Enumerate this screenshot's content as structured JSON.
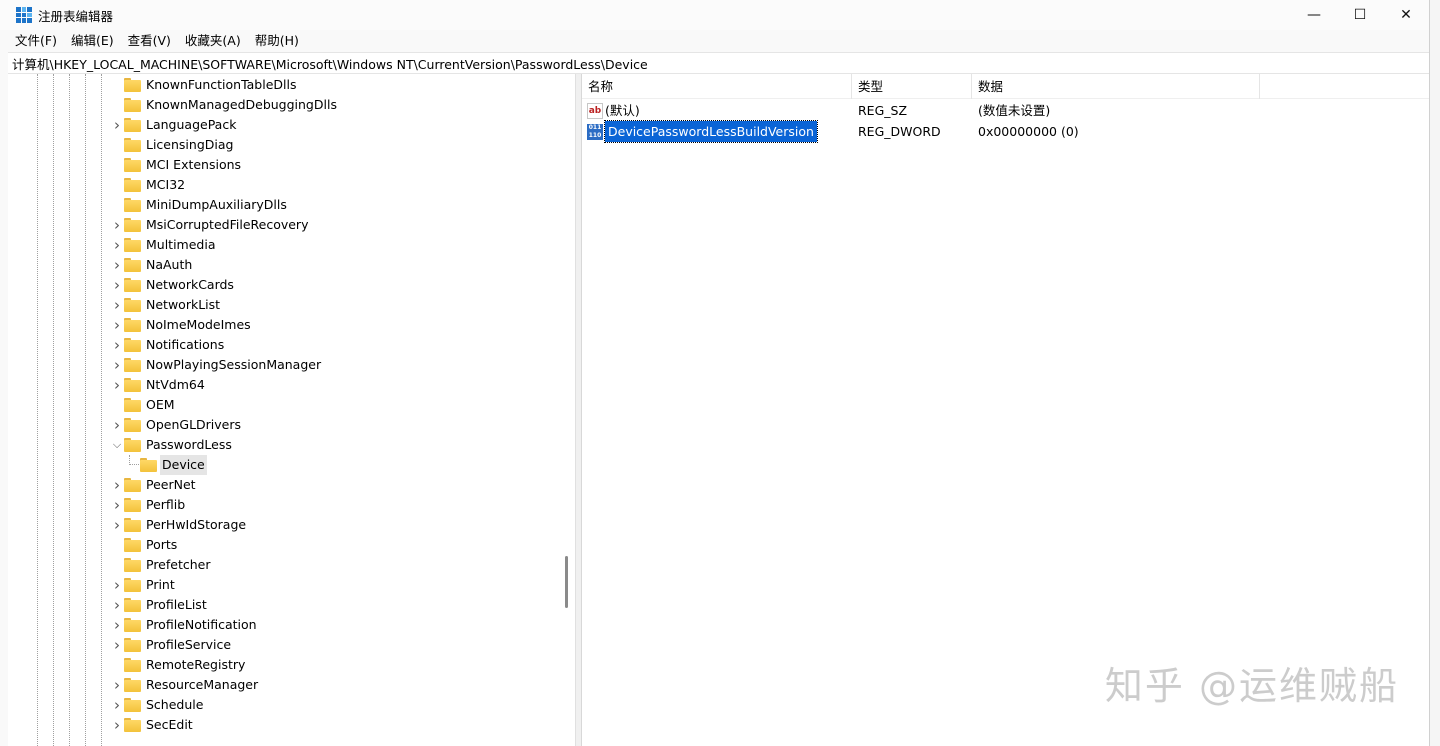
{
  "window": {
    "title": "注册表编辑器",
    "controls": {
      "minimize": "—",
      "maximize": "☐",
      "close": "✕"
    }
  },
  "menu": [
    "文件(F)",
    "编辑(E)",
    "查看(V)",
    "收藏夹(A)",
    "帮助(H)"
  ],
  "address": "计算机\\HKEY_LOCAL_MACHINE\\SOFTWARE\\Microsoft\\Windows NT\\CurrentVersion\\PasswordLess\\Device",
  "tree": [
    {
      "label": "KnownFunctionTableDlls",
      "expandable": false
    },
    {
      "label": "KnownManagedDebuggingDlls",
      "expandable": false
    },
    {
      "label": "LanguagePack",
      "expandable": true
    },
    {
      "label": "LicensingDiag",
      "expandable": false
    },
    {
      "label": "MCI Extensions",
      "expandable": false
    },
    {
      "label": "MCI32",
      "expandable": false
    },
    {
      "label": "MiniDumpAuxiliaryDlls",
      "expandable": false
    },
    {
      "label": "MsiCorruptedFileRecovery",
      "expandable": true
    },
    {
      "label": "Multimedia",
      "expandable": true
    },
    {
      "label": "NaAuth",
      "expandable": true
    },
    {
      "label": "NetworkCards",
      "expandable": true
    },
    {
      "label": "NetworkList",
      "expandable": true
    },
    {
      "label": "NoImeModeImes",
      "expandable": true
    },
    {
      "label": "Notifications",
      "expandable": true
    },
    {
      "label": "NowPlayingSessionManager",
      "expandable": true
    },
    {
      "label": "NtVdm64",
      "expandable": true
    },
    {
      "label": "OEM",
      "expandable": false
    },
    {
      "label": "OpenGLDrivers",
      "expandable": true
    },
    {
      "label": "PasswordLess",
      "expandable": true,
      "expanded": true
    },
    {
      "label": "Device",
      "child": true,
      "selected": true
    },
    {
      "label": "PeerNet",
      "expandable": true
    },
    {
      "label": "Perflib",
      "expandable": true
    },
    {
      "label": "PerHwIdStorage",
      "expandable": true
    },
    {
      "label": "Ports",
      "expandable": false
    },
    {
      "label": "Prefetcher",
      "expandable": false
    },
    {
      "label": "Print",
      "expandable": true
    },
    {
      "label": "ProfileList",
      "expandable": true
    },
    {
      "label": "ProfileNotification",
      "expandable": true
    },
    {
      "label": "ProfileService",
      "expandable": true
    },
    {
      "label": "RemoteRegistry",
      "expandable": false
    },
    {
      "label": "ResourceManager",
      "expandable": true
    },
    {
      "label": "Schedule",
      "expandable": true
    },
    {
      "label": "SecEdit",
      "expandable": true
    }
  ],
  "list": {
    "headers": {
      "name": "名称",
      "type": "类型",
      "data": "数据"
    },
    "rows": [
      {
        "icon": "string-value-icon",
        "icon_text": "ab",
        "name": "(默认)",
        "type": "REG_SZ",
        "data": "(数值未设置)",
        "selected": false
      },
      {
        "icon": "dword-value-icon",
        "icon_text": "011\n110",
        "name": "DevicePasswordLessBuildVersion",
        "type": "REG_DWORD",
        "data": "0x00000000 (0)",
        "selected": true
      }
    ]
  },
  "watermark": "知乎 @运维贼船",
  "colors": {
    "selection": "#0a64d6",
    "folder": "#f3c23b",
    "tree_highlight": "#e5e5e5"
  }
}
